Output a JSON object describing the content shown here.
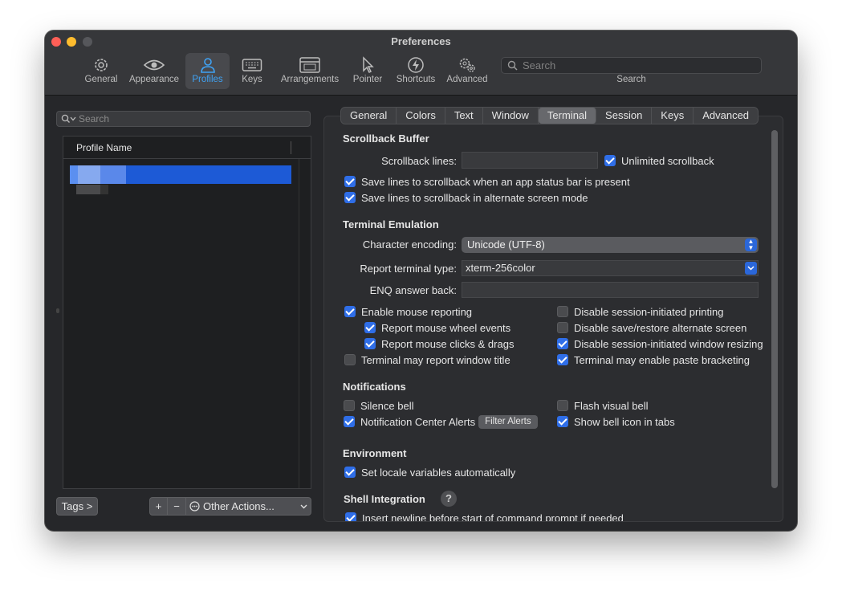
{
  "window": {
    "title": "Preferences"
  },
  "toolbar": {
    "items": [
      {
        "label": "General",
        "icon": "gear-icon"
      },
      {
        "label": "Appearance",
        "icon": "eye-icon"
      },
      {
        "label": "Profiles",
        "icon": "person-icon",
        "selected": true
      },
      {
        "label": "Keys",
        "icon": "keyboard-icon"
      },
      {
        "label": "Arrangements",
        "icon": "window-icon"
      },
      {
        "label": "Pointer",
        "icon": "pointer-icon"
      },
      {
        "label": "Shortcuts",
        "icon": "bolt-icon"
      },
      {
        "label": "Advanced",
        "icon": "gears-icon"
      }
    ],
    "search_placeholder": "Search",
    "search_label": "Search"
  },
  "profiles": {
    "search_placeholder": "Search",
    "column_header": "Profile Name",
    "tags_label": "Tags >",
    "add_label": "+",
    "remove_label": "−",
    "other_actions_label": "Other Actions..."
  },
  "tabs": [
    "General",
    "Colors",
    "Text",
    "Window",
    "Terminal",
    "Session",
    "Keys",
    "Advanced"
  ],
  "active_tab": "Terminal",
  "scrollback": {
    "title": "Scrollback Buffer",
    "lines_label": "Scrollback lines:",
    "lines_value": "",
    "unlimited": "Unlimited scrollback",
    "save_status_bar": "Save lines to scrollback when an app status bar is present",
    "save_alt_screen": "Save lines to scrollback in alternate screen mode"
  },
  "emulation": {
    "title": "Terminal Emulation",
    "encoding_label": "Character encoding:",
    "encoding_value": "Unicode (UTF-8)",
    "type_label": "Report terminal type:",
    "type_value": "xterm-256color",
    "enq_label": "ENQ answer back:",
    "enq_value": "",
    "mouse_reporting": "Enable mouse reporting",
    "wheel_events": "Report mouse wheel events",
    "clicks_drags": "Report mouse clicks & drags",
    "window_title": "Terminal may report window title",
    "disable_printing": "Disable session-initiated printing",
    "disable_save_restore": "Disable save/restore alternate screen",
    "disable_resizing": "Disable session-initiated window resizing",
    "paste_bracketing": "Terminal may enable paste bracketing"
  },
  "notifications": {
    "title": "Notifications",
    "silence_bell": "Silence bell",
    "center_alerts": "Notification Center Alerts",
    "filter_alerts": "Filter Alerts",
    "flash_bell": "Flash visual bell",
    "bell_icon": "Show bell icon in tabs"
  },
  "environment": {
    "title": "Environment",
    "locale": "Set locale variables automatically"
  },
  "shell": {
    "title": "Shell Integration",
    "help": "?",
    "newline": "Insert newline before start of command prompt if needed"
  },
  "colors": {
    "accent": "#2f6ee8",
    "selected_tool": "#3fa3f5",
    "selection": "#1d5ad6"
  }
}
